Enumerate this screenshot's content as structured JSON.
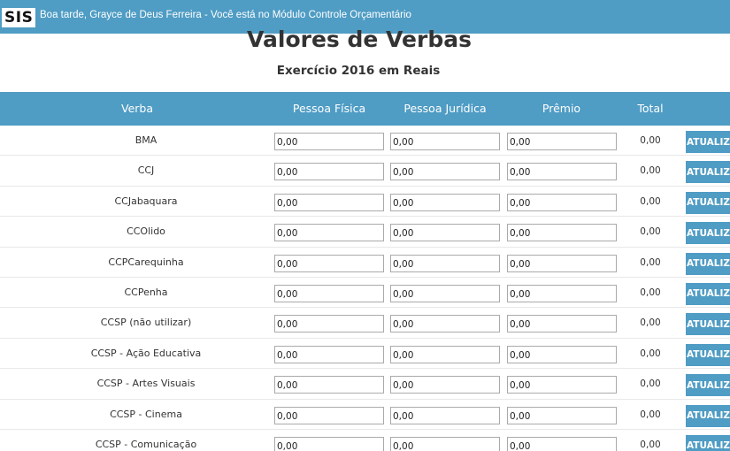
{
  "header": {
    "logo_text": "SIS",
    "greeting": "Boa tarde, Grayce de Deus Ferreira - Você está no Módulo Controle Orçamentário"
  },
  "page": {
    "title": "Valores de Verbas",
    "subtitle": "Exercício 2016 em Reais"
  },
  "table": {
    "columns": [
      "Verba",
      "Pessoa Física",
      "Pessoa Jurídica",
      "Prêmio",
      "Total"
    ],
    "button_label": "ATUALIZAR",
    "rows": [
      {
        "verba": "BMA",
        "pessoa_fisica": "0,00",
        "pessoa_juridica": "0,00",
        "premio": "0,00",
        "total": "0,00"
      },
      {
        "verba": "CCJ",
        "pessoa_fisica": "0,00",
        "pessoa_juridica": "0,00",
        "premio": "0,00",
        "total": "0,00"
      },
      {
        "verba": "CCJabaquara",
        "pessoa_fisica": "0,00",
        "pessoa_juridica": "0,00",
        "premio": "0,00",
        "total": "0,00"
      },
      {
        "verba": "CCOlido",
        "pessoa_fisica": "0,00",
        "pessoa_juridica": "0,00",
        "premio": "0,00",
        "total": "0,00"
      },
      {
        "verba": "CCPCarequinha",
        "pessoa_fisica": "0,00",
        "pessoa_juridica": "0,00",
        "premio": "0,00",
        "total": "0,00"
      },
      {
        "verba": "CCPenha",
        "pessoa_fisica": "0,00",
        "pessoa_juridica": "0,00",
        "premio": "0,00",
        "total": "0,00"
      },
      {
        "verba": "CCSP (não utilizar)",
        "pessoa_fisica": "0,00",
        "pessoa_juridica": "0,00",
        "premio": "0,00",
        "total": "0,00"
      },
      {
        "verba": "CCSP - Ação Educativa",
        "pessoa_fisica": "0,00",
        "pessoa_juridica": "0,00",
        "premio": "0,00",
        "total": "0,00"
      },
      {
        "verba": "CCSP - Artes Visuais",
        "pessoa_fisica": "0,00",
        "pessoa_juridica": "0,00",
        "premio": "0,00",
        "total": "0,00"
      },
      {
        "verba": "CCSP - Cinema",
        "pessoa_fisica": "0,00",
        "pessoa_juridica": "0,00",
        "premio": "0,00",
        "total": "0,00"
      },
      {
        "verba": "CCSP - Comunicação",
        "pessoa_fisica": "0,00",
        "pessoa_juridica": "0,00",
        "premio": "0,00",
        "total": "0,00"
      }
    ]
  },
  "colors": {
    "accent": "#4f9cc4",
    "header_text": "#ffffff"
  }
}
